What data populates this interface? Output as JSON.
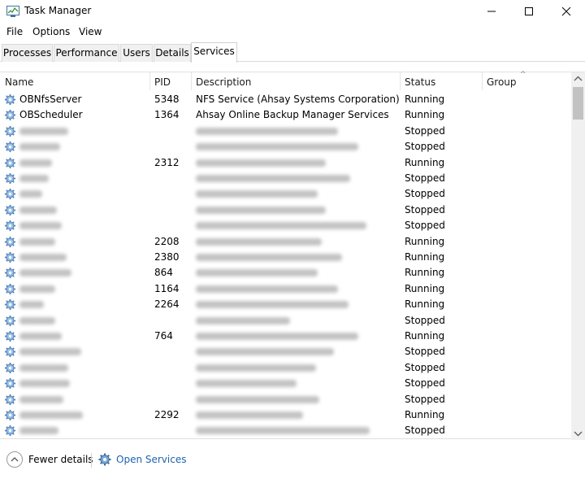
{
  "window": {
    "title": "Task Manager",
    "icon": "task-manager-icon",
    "controls": [
      "minimize-icon",
      "maximize-icon",
      "close-icon"
    ]
  },
  "menu": [
    "File",
    "Options",
    "View"
  ],
  "tabs": [
    "Processes",
    "Performance",
    "Users",
    "Details",
    "Services"
  ],
  "active_tab": "Services",
  "columns": {
    "name": "Name",
    "pid": "PID",
    "description": "Description",
    "status": "Status",
    "group": "Group"
  },
  "sort_indicator": "^",
  "rows": [
    {
      "name": "OBNfsServer",
      "pid": "5348",
      "description": "NFS Service (Ahsay Systems Corporation)",
      "status": "Running",
      "blurred": false
    },
    {
      "name": "OBScheduler",
      "pid": "1364",
      "description": "Ahsay Online Backup Manager Services",
      "status": "Running",
      "blurred": false
    },
    {
      "name": "",
      "pid": "",
      "description": "",
      "status": "Stopped",
      "blurred": true
    },
    {
      "name": "",
      "pid": "",
      "description": "",
      "status": "Stopped",
      "blurred": true
    },
    {
      "name": "",
      "pid": "2312",
      "description": "",
      "status": "Running",
      "blurred": true
    },
    {
      "name": "",
      "pid": "",
      "description": "",
      "status": "Stopped",
      "blurred": true
    },
    {
      "name": "",
      "pid": "",
      "description": "",
      "status": "Stopped",
      "blurred": true
    },
    {
      "name": "",
      "pid": "",
      "description": "",
      "status": "Stopped",
      "blurred": true
    },
    {
      "name": "",
      "pid": "",
      "description": "",
      "status": "Stopped",
      "blurred": true
    },
    {
      "name": "",
      "pid": "2208",
      "description": "",
      "status": "Running",
      "blurred": true
    },
    {
      "name": "",
      "pid": "2380",
      "description": "",
      "status": "Running",
      "blurred": true
    },
    {
      "name": "",
      "pid": "864",
      "description": "",
      "status": "Running",
      "blurred": true
    },
    {
      "name": "",
      "pid": "1164",
      "description": "",
      "status": "Running",
      "blurred": true
    },
    {
      "name": "",
      "pid": "2264",
      "description": "",
      "status": "Running",
      "blurred": true
    },
    {
      "name": "",
      "pid": "",
      "description": "",
      "status": "Stopped",
      "blurred": true
    },
    {
      "name": "",
      "pid": "764",
      "description": "",
      "status": "Running",
      "blurred": true
    },
    {
      "name": "",
      "pid": "",
      "description": "",
      "status": "Stopped",
      "blurred": true
    },
    {
      "name": "",
      "pid": "",
      "description": "",
      "status": "Stopped",
      "blurred": true
    },
    {
      "name": "",
      "pid": "",
      "description": "",
      "status": "Stopped",
      "blurred": true
    },
    {
      "name": "",
      "pid": "",
      "description": "",
      "status": "Stopped",
      "blurred": true
    },
    {
      "name": "",
      "pid": "2292",
      "description": "",
      "status": "Running",
      "blurred": true
    },
    {
      "name": "",
      "pid": "",
      "description": "",
      "status": "Stopped",
      "blurred": true
    }
  ],
  "footer": {
    "fewer_details": "Fewer details",
    "open_services": "Open Services"
  },
  "colors": {
    "link": "#1e62b0",
    "gear": "#4a7fb8"
  }
}
